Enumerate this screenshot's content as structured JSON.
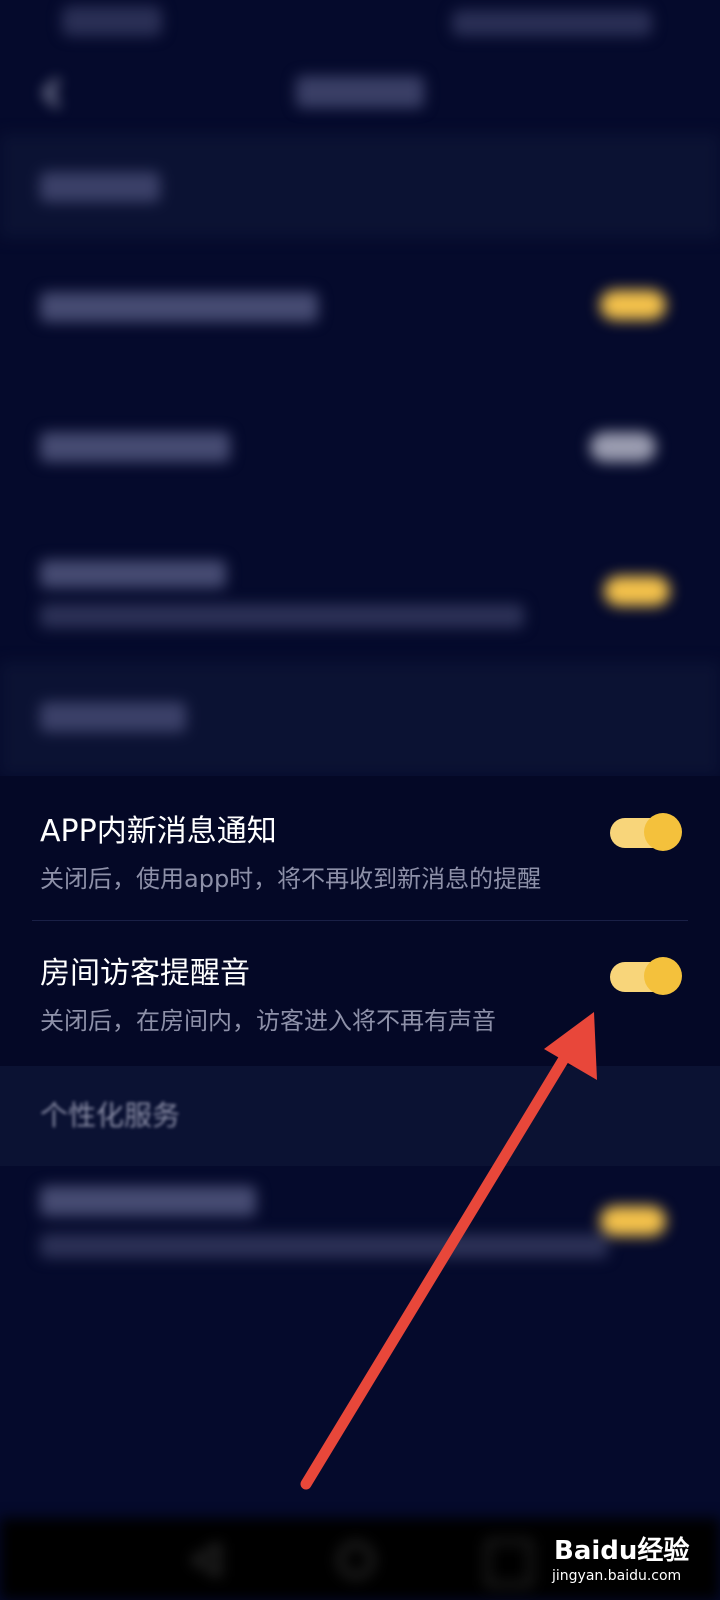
{
  "colors": {
    "background": "#050a2c",
    "toggle_on": "#f4c13c",
    "annotation_arrow": "#e8473a"
  },
  "settings": {
    "in_app_notification": {
      "title": "APP内新消息通知",
      "subtitle": "关闭后，使用app时，将不再收到新消息的提醒",
      "enabled": true
    },
    "visitor_sound": {
      "title": "房间访客提醒音",
      "subtitle": "关闭后，在房间内，访客进入将不再有声音",
      "enabled": true
    }
  },
  "sections": {
    "personalized_services": "个性化服务"
  },
  "watermark": {
    "brand": "Baidu经验",
    "url": "jingyan.baidu.com"
  },
  "icons": {
    "back": "chevron-left-icon",
    "nav_back": "triangle-back-icon",
    "nav_home": "circle-home-icon",
    "nav_recent": "square-recent-icon"
  }
}
